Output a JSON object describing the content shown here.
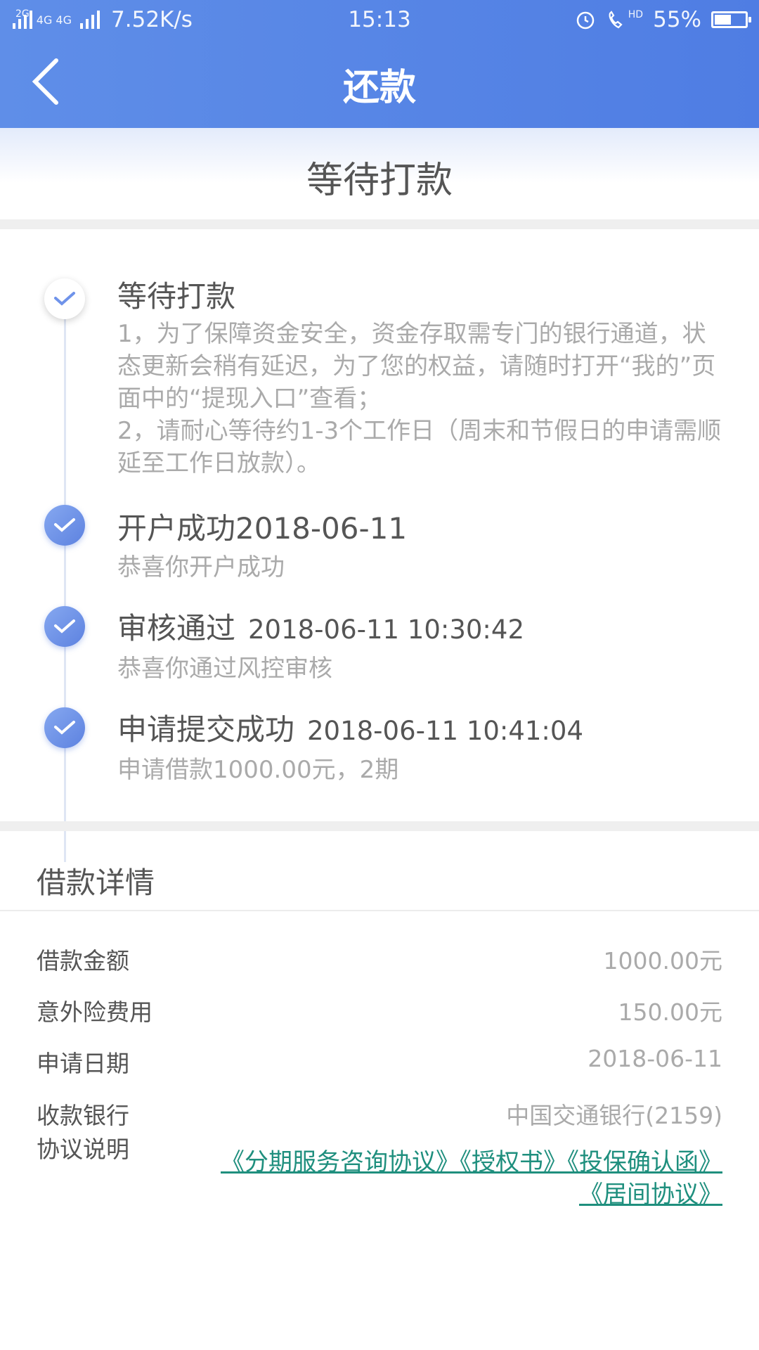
{
  "status_bar": {
    "net1": "2G",
    "net2": "4G 4G",
    "speed": "7.52K/s",
    "time": "15:13",
    "hd": "HD",
    "battery_percent": "55%",
    "battery_level": 0.55
  },
  "header": {
    "title": "还款"
  },
  "banner": {
    "status": "等待打款"
  },
  "timeline": [
    {
      "title": "等待打款",
      "time": "",
      "desc": "1，为了保障资金安全，资金存取需专门的银行通道，状态更新会稍有延迟，为了您的权益，请随时打开“我的”页面中的“提现入口”查看；\n2，请耐心等待约1-3个工作日（周末和节假日的申请需顺延至工作日放款）。",
      "state": "current"
    },
    {
      "title": "开户成功2018-06-11",
      "time": "",
      "desc": "恭喜你开户成功",
      "state": "done"
    },
    {
      "title": "审核通过",
      "time": "2018-06-11 10:30:42",
      "desc": "恭喜你通过风控审核",
      "state": "done"
    },
    {
      "title": "申请提交成功",
      "time": "2018-06-11 10:41:04",
      "desc": "申请借款1000.00元，2期",
      "state": "done"
    }
  ],
  "details": {
    "title": "借款详情",
    "rows": [
      {
        "label": "借款金额",
        "value": "1000.00元"
      },
      {
        "label": "意外险费用",
        "value": "150.00元"
      },
      {
        "label": "申请日期",
        "value": "2018-06-11"
      },
      {
        "label": "收款银行",
        "value": "中国交通银行(2159)"
      }
    ],
    "agreement_label": "协议说明",
    "agreements": [
      "《分期服务咨询协议》",
      "《授权书》",
      "《投保确认函》",
      "《居间协议》"
    ]
  },
  "colors": {
    "header": "#5a88e6",
    "link": "#1f8f7e",
    "accent_dot": "#6f93ea"
  }
}
